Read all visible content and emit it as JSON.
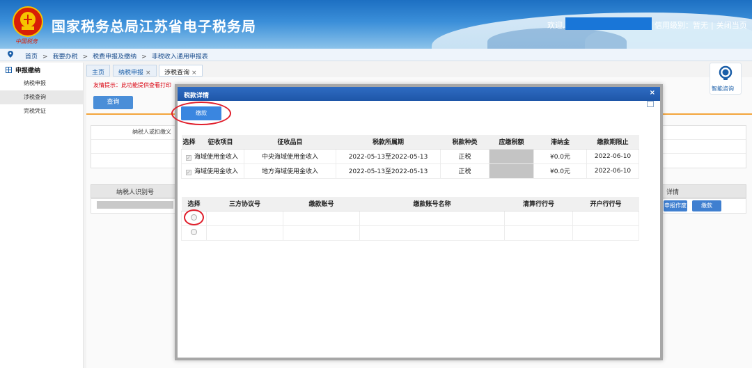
{
  "header": {
    "site_title": "国家税务总局江苏省电子税务局",
    "emblem_caption": "中国税务",
    "welcome": "欢迎,",
    "credit": "信用级别：暂无",
    "close_page": "关闭当页"
  },
  "breadcrumb": {
    "items": [
      "首页",
      "我要办税",
      "税费申报及缴纳",
      "非税收入通用申报表"
    ],
    "separator": ">"
  },
  "sidebar": {
    "section": "申报缴纳",
    "items": [
      {
        "label": "纳税申报"
      },
      {
        "label": "涉税查询"
      },
      {
        "label": "完税凭证"
      }
    ]
  },
  "tabs": [
    {
      "label": "主页"
    },
    {
      "label": "纳税申报"
    },
    {
      "label": "涉税查询"
    }
  ],
  "tab_close": "×",
  "page": {
    "notice": "友情提示：此功能提供查看打印",
    "query_button": "查询",
    "bg_label": "纳税人或扣缴义",
    "bg_header_taxpayer_id": "纳税人识别号",
    "bg_header_detail": "详情",
    "bg_btn_report": "申报作废",
    "bg_btn_pay": "缴款"
  },
  "helper": {
    "label": "智能咨询"
  },
  "modal": {
    "title": "税款详情",
    "close": "×",
    "pay_button": "缴款",
    "table1": {
      "headers": [
        "选择",
        "征收项目",
        "征收品目",
        "税款所属期",
        "税款种类",
        "应缴税额",
        "滞纳金",
        "缴款期限止"
      ],
      "rows": [
        {
          "item": "海域使用金收入",
          "subitem": "中央海域使用金收入",
          "period": "2022-05-13至2022-05-13",
          "kind": "正税",
          "amount": "",
          "late_fee": "¥0.0元",
          "deadline": "2022-06-10"
        },
        {
          "item": "海域使用金收入",
          "subitem": "地方海域使用金收入",
          "period": "2022-05-13至2022-05-13",
          "kind": "正税",
          "amount": "",
          "late_fee": "¥0.0元",
          "deadline": "2022-06-10"
        }
      ]
    },
    "table2": {
      "headers": [
        "选择",
        "三方协议号",
        "缴款账号",
        "缴款账号名称",
        "清算行行号",
        "开户行行号"
      ]
    }
  },
  "colors": {
    "brand_blue": "#1e56a8",
    "accent_red": "#e01d2a",
    "notice_red": "#d9000d",
    "orange_rule": "#f3a43a"
  }
}
